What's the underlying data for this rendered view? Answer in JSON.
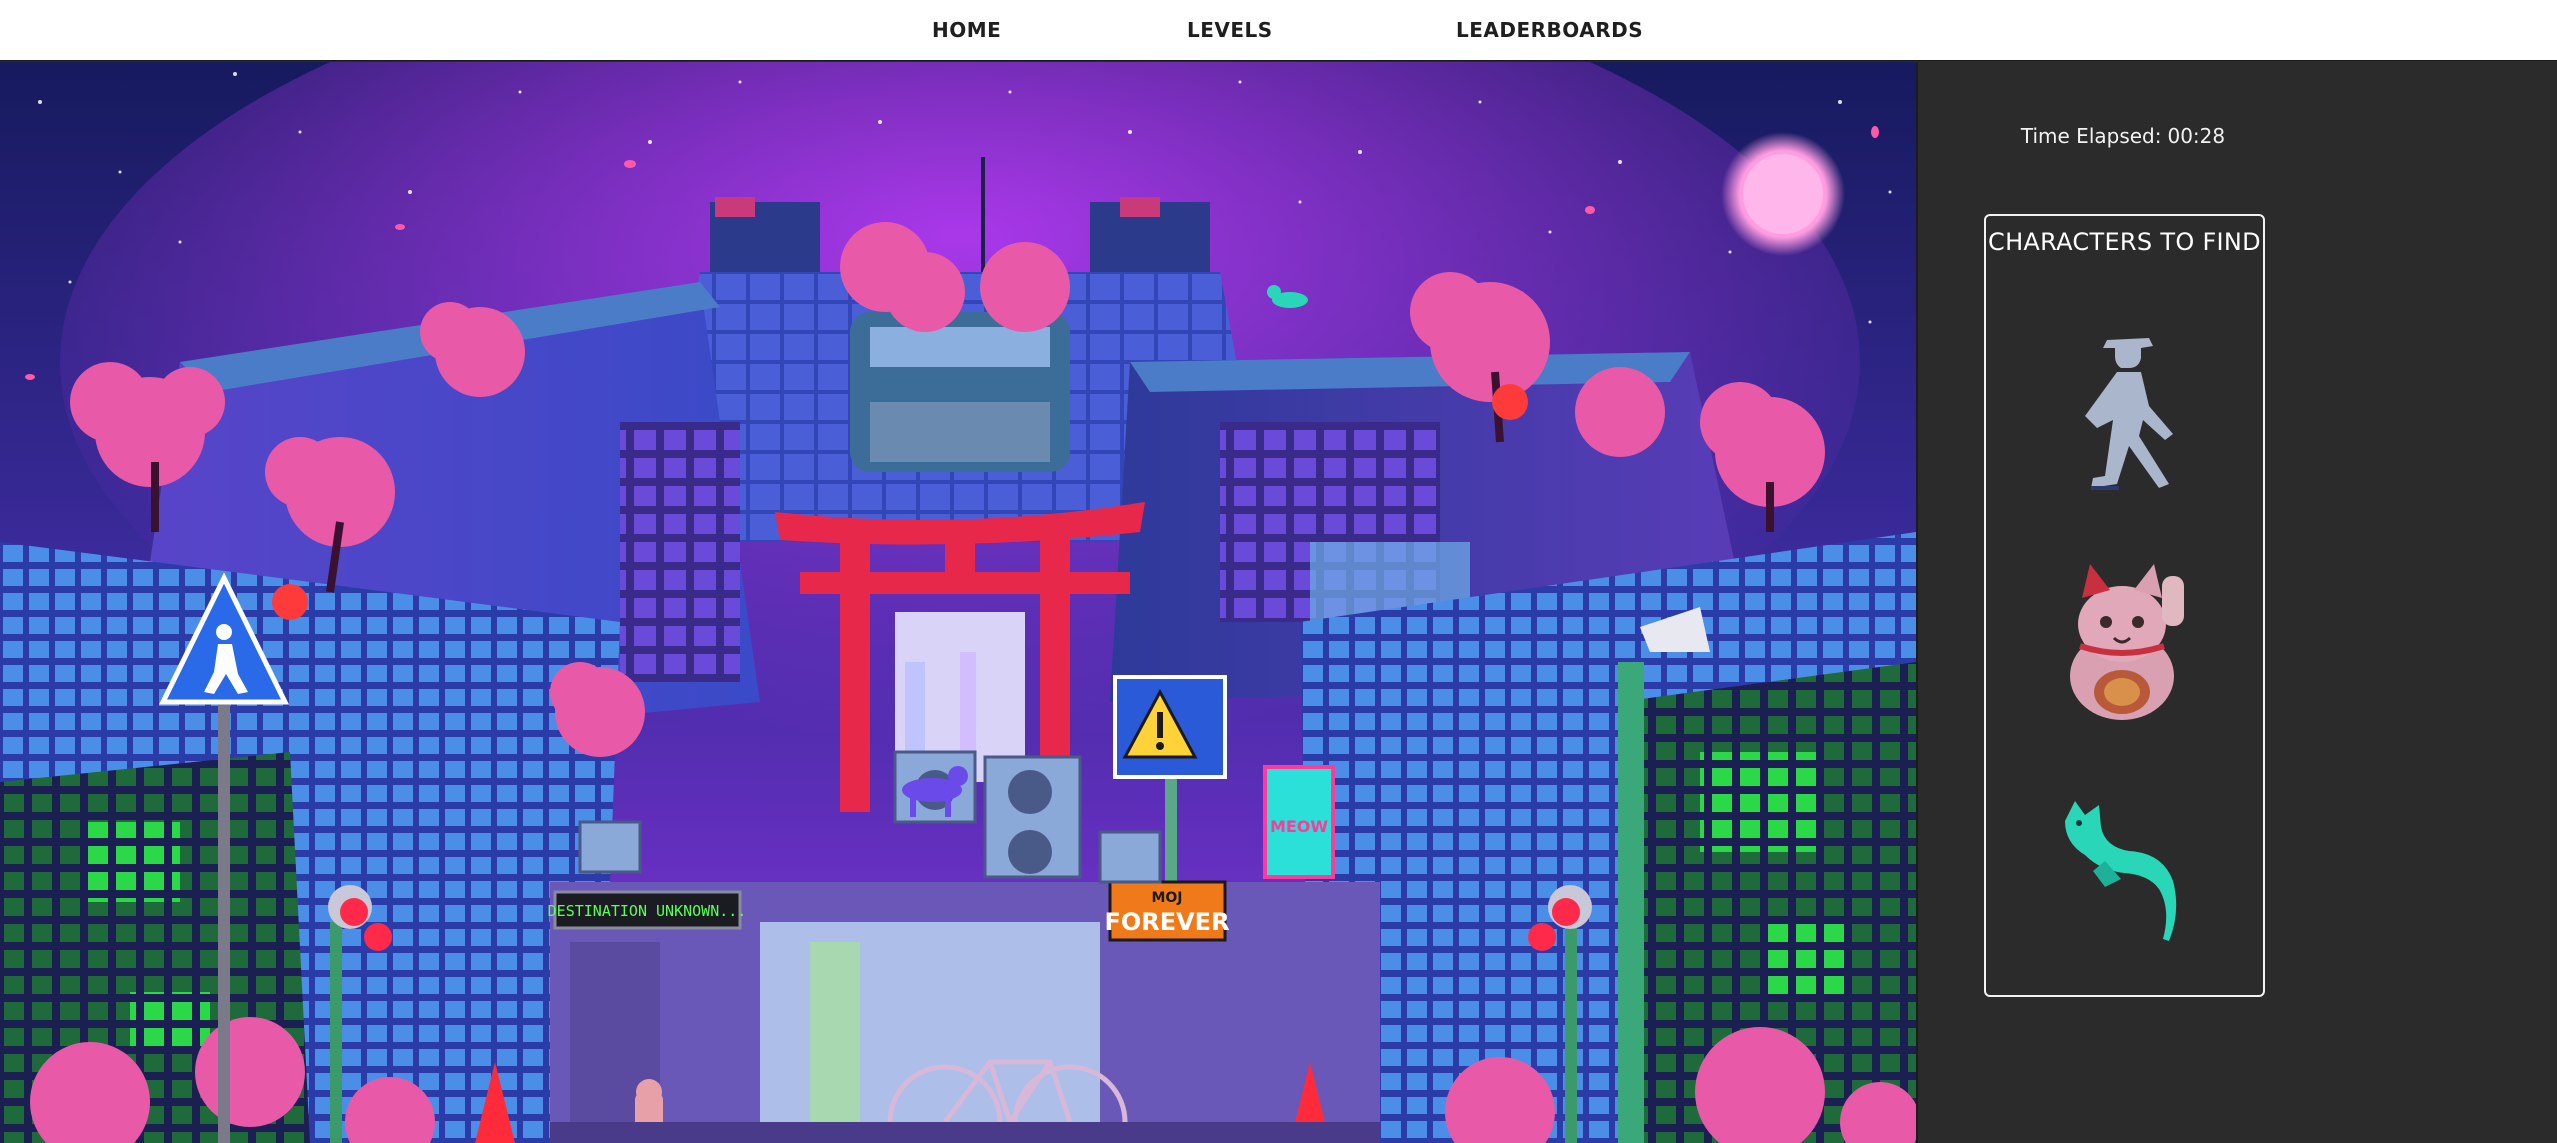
{
  "nav": {
    "items": [
      {
        "label": "HOME"
      },
      {
        "label": "LEVELS"
      },
      {
        "label": "LEADERBOARDS"
      }
    ]
  },
  "scene": {
    "signs": {
      "destination": "DESTINATION UNKNOWN...",
      "forever_top": "MOJ",
      "forever_main": "FOREVER",
      "neon": "MEOW"
    },
    "colors": {
      "sky_top": "#1a1f6e",
      "sky_bottom": "#7a2ad8",
      "blossom": "#e85aa8",
      "torii": "#e8284a",
      "moon": "#ff9ee0",
      "building_blue": "#3a5ad0",
      "building_dark": "#24307a",
      "window_green": "#2ad848"
    }
  },
  "panel": {
    "timer_label": "Time Elapsed:",
    "timer_value": "00:28",
    "find_title": "CHARACTERS TO FIND",
    "characters": [
      {
        "name": "crosswalk-walker",
        "icon": "walking-man-icon",
        "color": "#a9b6cc"
      },
      {
        "name": "lucky-cat",
        "icon": "maneki-neko-icon",
        "color": "#d46a7a"
      },
      {
        "name": "teal-cat",
        "icon": "sleeping-cat-icon",
        "color": "#2ad6b8"
      }
    ]
  }
}
